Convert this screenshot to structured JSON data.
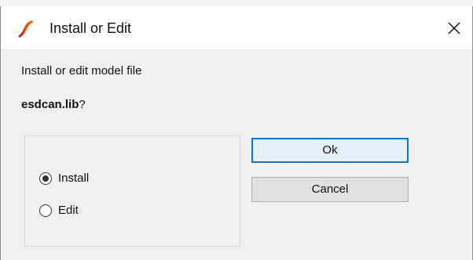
{
  "dialog": {
    "title": "Install or Edit",
    "prompt": "Install or edit model file",
    "filename": "esdcan.lib",
    "filename_suffix": "?",
    "options": [
      {
        "label": "Install",
        "selected": true
      },
      {
        "label": "Edit",
        "selected": false
      }
    ],
    "buttons": {
      "ok": "Ok",
      "cancel": "Cancel"
    }
  },
  "icons": {
    "app": "simetrix-app-icon",
    "close": "close-icon"
  },
  "colors": {
    "dialog_bg": "#f0f0f0",
    "titlebar_bg": "#ffffff",
    "focus_blue": "#0078d7",
    "app_icon_red": "#e50914",
    "app_icon_orange": "#ff7a00"
  }
}
